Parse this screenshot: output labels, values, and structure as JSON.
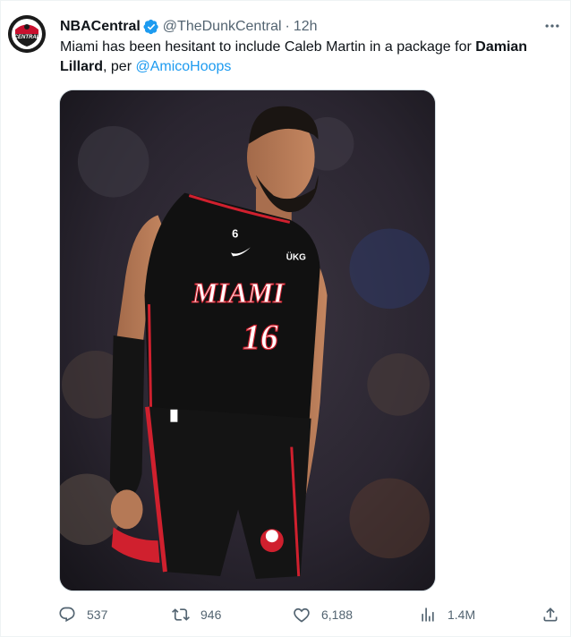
{
  "tweet": {
    "display_name": "NBACentral",
    "handle": "@TheDunkCentral",
    "separator": "·",
    "time": "12h",
    "text_part1": "Miami has been hesitant to include Caleb Martin in a package for ",
    "text_bold": "Damian Lillard",
    "text_part2": ", per ",
    "mention": "@AmicoHoops",
    "avatar_logo_text": "CENTRAL",
    "jersey": {
      "team": "MIAMI",
      "number": "16",
      "shoulder_number": "6",
      "patch": "ÜKG"
    }
  },
  "actions": {
    "replies": "537",
    "retweets": "946",
    "likes": "6,188",
    "views": "1.4M"
  },
  "icons": {
    "verified": "verified-badge-icon",
    "more": "more-icon",
    "reply": "reply-icon",
    "retweet": "retweet-icon",
    "like": "heart-icon",
    "views": "views-icon",
    "share": "share-icon"
  },
  "colors": {
    "text": "#0f1419",
    "secondary": "#536471",
    "link": "#1d9bf0",
    "jersey": "#111111",
    "jersey_trim": "#d0202e"
  }
}
